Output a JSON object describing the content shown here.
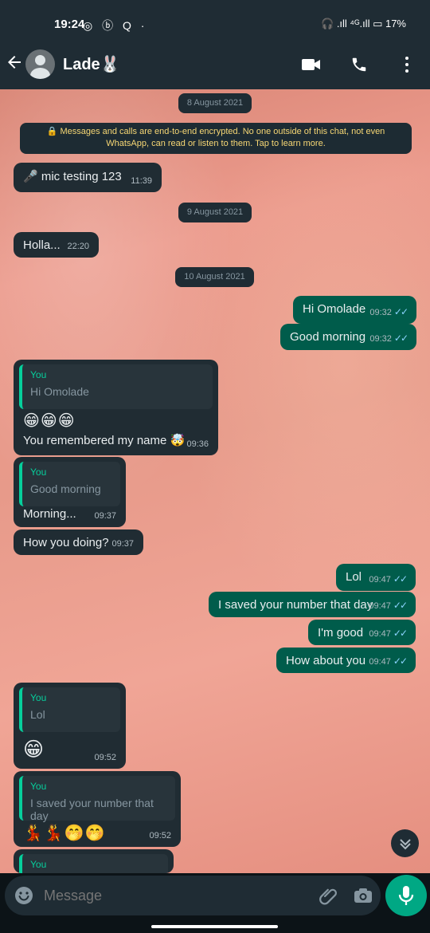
{
  "status_bar": {
    "time": "19:24",
    "left_icons": "◎ ⓑ Q ·",
    "right_icons": "🎧 .ıll ⁴ᴳ.ıll ▭ 17%"
  },
  "chat": {
    "contact_name": "Lade🐰",
    "dates": [
      "8 August 2021",
      "9 August 2021",
      "10 August 2021"
    ],
    "encryption_notice": "🔒 Messages and calls are end-to-end encrypted. No one outside of this chat, not even WhatsApp, can read or listen to them. Tap to learn more.",
    "messages": [
      {
        "text": "🎤 mic testing 123",
        "time": "11:39"
      },
      {
        "text": "Holla...",
        "time": "22:20"
      },
      {
        "text": "Hi Omolade",
        "time": "09:32"
      },
      {
        "text": "Good morning",
        "time": "09:32"
      },
      {
        "quote_author": "You",
        "quote": "Hi Omolade",
        "emoji": "😁😁😁",
        "text": "You remembered my name 🤯",
        "time": "09:36"
      },
      {
        "quote_author": "You",
        "quote": "Good morning",
        "text": "Morning...",
        "time": "09:37"
      },
      {
        "text": "How you doing?",
        "time": "09:37"
      },
      {
        "text": "Lol",
        "time": "09:47"
      },
      {
        "text": "I saved your number that day",
        "time": "09:47"
      },
      {
        "text": "I'm good",
        "time": "09:47"
      },
      {
        "text": "How about you",
        "time": "09:47"
      },
      {
        "quote_author": "You",
        "quote": "Lol",
        "emoji": "😁",
        "time": "09:52"
      },
      {
        "quote_author": "You",
        "quote": "I saved your number that day",
        "emoji": "💃💃🤭🤭",
        "time": "09:52"
      },
      {
        "quote_author": "You"
      }
    ]
  },
  "composer": {
    "placeholder": "Message"
  },
  "colors": {
    "accent": "#00a884",
    "incoming_bubble": "#202c33",
    "outgoing_bubble": "#005c4b"
  }
}
